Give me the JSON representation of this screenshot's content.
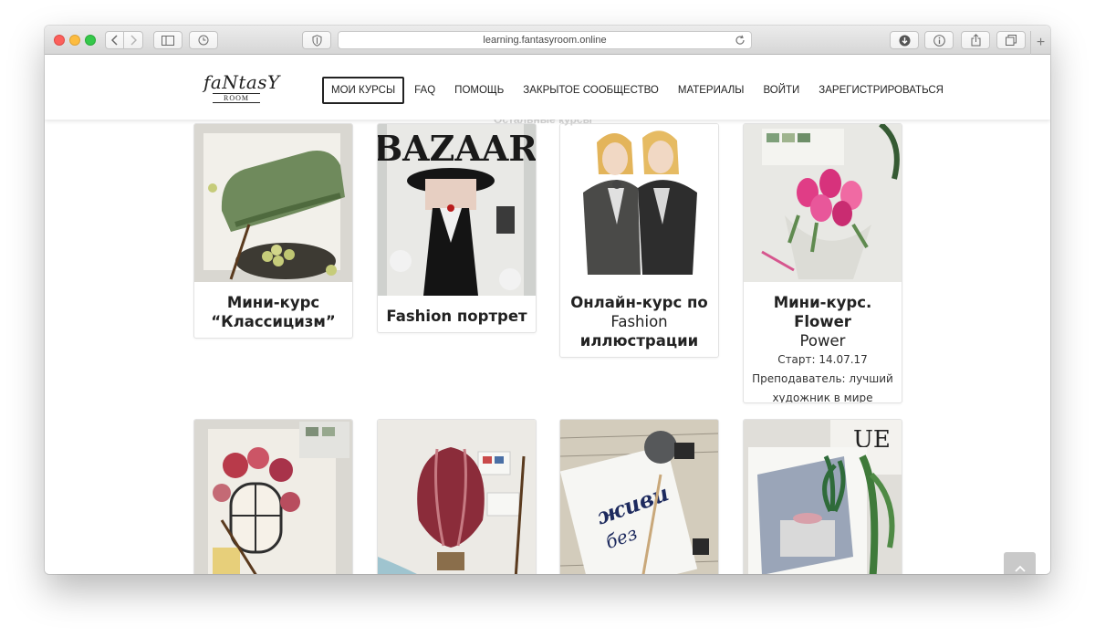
{
  "browser": {
    "url": "learning.fantasyroom.online",
    "icons": {
      "back": "chevron-left-icon",
      "forward": "chevron-right-icon",
      "sidebar": "sidebar-icon",
      "history": "clock-icon",
      "privacy": "shield-icon",
      "reload": "reload-icon",
      "download": "download-icon",
      "info": "info-icon",
      "share": "share-icon",
      "tabs": "tabs-icon",
      "new_tab": "+"
    }
  },
  "site": {
    "logo": {
      "main": "faNtasY",
      "sub": "ROOM"
    },
    "nav": [
      {
        "label": "МОИ КУРСЫ",
        "active": true
      },
      {
        "label": "FAQ"
      },
      {
        "label": "ПОМОЩЬ"
      },
      {
        "label": "ЗАКРЫТОЕ СООБЩЕСТВО"
      },
      {
        "label": "МАТЕРИАЛЫ"
      },
      {
        "label": "ВОЙТИ"
      },
      {
        "label": "ЗАРЕГИСТРИРОВАТЬСЯ"
      }
    ],
    "ghost_heading": "Остальные курсы"
  },
  "courses": [
    {
      "title_line1": "Мини-курс",
      "title_line2": "“Классицизм”",
      "image": "green-sofa-illustration"
    },
    {
      "title_line1": "Fashion портрет",
      "image": "bazaar-fashion-illustration"
    },
    {
      "title_line1": "Онлайн-курс по",
      "title_line2": "Fashion",
      "title_line3": "иллюстрации",
      "image": "two-women-illustration"
    },
    {
      "title_line1": "Мини-курс. Flower",
      "title_line2": "Power",
      "start": "Старт: 14.07.17",
      "teacher_line1": "Преподаватель: лучший",
      "teacher_line2": "художник в мире",
      "image": "pink-tulips-illustration"
    },
    {
      "image": "flower-window-illustration"
    },
    {
      "image": "hot-air-balloon-illustration"
    },
    {
      "image": "lettering-illustration"
    },
    {
      "image": "interior-plant-illustration"
    }
  ],
  "scroll_top": {
    "icon": "chevron-up-icon"
  },
  "colors": {
    "accent": "#222222",
    "card_border": "#e2e2e2",
    "scroll_button": "#c9c9c9"
  }
}
